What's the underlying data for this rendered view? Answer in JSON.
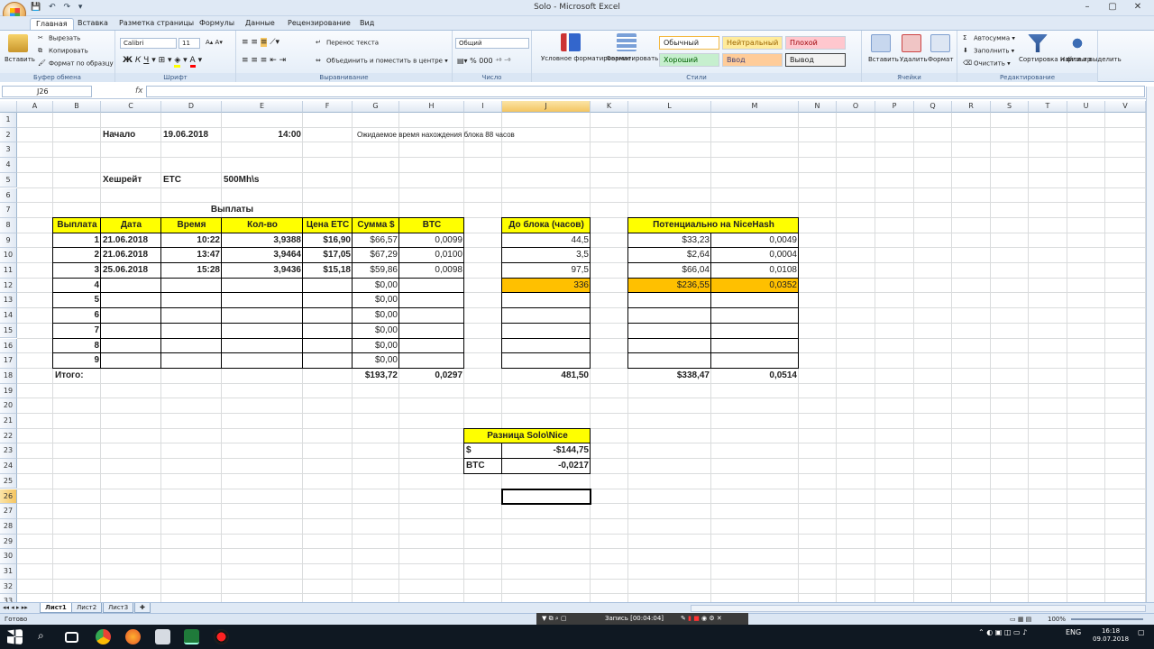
{
  "window": {
    "title": "Solo - Microsoft Excel",
    "controls": [
      "–",
      "▢",
      "✕"
    ]
  },
  "ribbon_tabs": [
    "Главная",
    "Вставка",
    "Разметка страницы",
    "Формулы",
    "Данные",
    "Рецензирование",
    "Вид"
  ],
  "ribbon": {
    "clipboard": {
      "label": "Буфер обмена",
      "paste": "Вставить",
      "cut": "Вырезать",
      "copy": "Копировать",
      "format_painter": "Формат по образцу"
    },
    "font": {
      "label": "Шрифт",
      "name": "Calibri",
      "size": "11"
    },
    "alignment": {
      "label": "Выравнивание",
      "wrap": "Перенос текста",
      "merge": "Объединить и поместить в центре"
    },
    "number": {
      "label": "Число",
      "format": "Общий"
    },
    "styles": {
      "label": "Стили",
      "cond_format": "Условное форматирование",
      "as_table": "Форматировать как таблицу",
      "normal": "Обычный",
      "neutral": "Нейтральный",
      "bad": "Плохой",
      "good": "Хороший",
      "input": "Ввод",
      "output": "Вывод"
    },
    "cells": {
      "label": "Ячейки",
      "insert": "Вставить",
      "delete": "Удалить",
      "format": "Формат"
    },
    "editing": {
      "label": "Редактирование",
      "autosum": "Автосумма",
      "fill": "Заполнить",
      "clear": "Очистить",
      "sort": "Сортировка и фильтр",
      "find": "Найти и выделить"
    }
  },
  "formula_bar": {
    "name_box": "J26",
    "fx": "fx",
    "formula": ""
  },
  "columns": [
    "A",
    "B",
    "C",
    "D",
    "E",
    "F",
    "G",
    "H",
    "I",
    "J",
    "K",
    "L",
    "M",
    "N",
    "O",
    "P",
    "Q",
    "R",
    "S",
    "T",
    "U",
    "V"
  ],
  "rows": [
    "1",
    "2",
    "3",
    "4",
    "5",
    "6",
    "7",
    "8",
    "9",
    "10",
    "11",
    "12",
    "13",
    "14",
    "15",
    "16",
    "17",
    "18",
    "19",
    "20",
    "21",
    "22",
    "23",
    "24",
    "25",
    "26",
    "27",
    "28",
    "29",
    "30",
    "31",
    "32",
    "33",
    "34"
  ],
  "cells": {
    "start_label": "Начало",
    "start_date": "19.06.2018",
    "start_time": "14:00",
    "expected_note": "Ожидаемое время нахождения блока 88 часов",
    "hashrate_label": "Хешрейт",
    "coin": "ETC",
    "hashrate": "500Mh\\s",
    "payouts_title": "Выплаты"
  },
  "payouts_table": {
    "headers": [
      "Выплата",
      "Дата",
      "Время",
      "Кол-во",
      "Цена ETC",
      "Сумма $",
      "BTC"
    ],
    "rows": [
      [
        "1",
        "21.06.2018",
        "10:22",
        "3,9388",
        "$16,90",
        "$66,57",
        "0,0099"
      ],
      [
        "2",
        "21.06.2018",
        "13:47",
        "3,9464",
        "$17,05",
        "$67,29",
        "0,0100"
      ],
      [
        "3",
        "25.06.2018",
        "15:28",
        "3,9436",
        "$15,18",
        "$59,86",
        "0,0098"
      ],
      [
        "4",
        "",
        "",
        "",
        "",
        "$0,00",
        ""
      ],
      [
        "5",
        "",
        "",
        "",
        "",
        "$0,00",
        ""
      ],
      [
        "6",
        "",
        "",
        "",
        "",
        "$0,00",
        ""
      ],
      [
        "7",
        "",
        "",
        "",
        "",
        "$0,00",
        ""
      ],
      [
        "8",
        "",
        "",
        "",
        "",
        "$0,00",
        ""
      ],
      [
        "9",
        "",
        "",
        "",
        "",
        "$0,00",
        ""
      ]
    ],
    "total_label": "Итого:",
    "total_usd": "$193,72",
    "total_btc": "0,0297"
  },
  "block_table": {
    "header": "До блока (часов)",
    "values": [
      "44,5",
      "3,5",
      "97,5",
      "336",
      "",
      "",
      "",
      "",
      ""
    ],
    "total": "481,50"
  },
  "nicehash_table": {
    "header": "Потенциально на NiceHash",
    "rows": [
      [
        "$33,23",
        "0,0049"
      ],
      [
        "$2,64",
        "0,0004"
      ],
      [
        "$66,04",
        "0,0108"
      ],
      [
        "$236,55",
        "0,0352"
      ],
      [
        "",
        ""
      ],
      [
        "",
        ""
      ],
      [
        "",
        ""
      ],
      [
        "",
        ""
      ],
      [
        "",
        ""
      ]
    ],
    "total_usd": "$338,47",
    "total_btc": "0,0514"
  },
  "diff_table": {
    "header": "Разница Solo\\Nice",
    "rows": [
      [
        "$",
        "-$144,75"
      ],
      [
        "BTC",
        "-0,0217"
      ]
    ]
  },
  "sheets": [
    "Лист1",
    "Лист2",
    "Лист3"
  ],
  "status": {
    "ready": "Готово",
    "recording": "Запись [00:04:04]",
    "zoom": "100%"
  },
  "tray": {
    "lang": "ENG",
    "time": "16:18",
    "date": "09.07.2018"
  },
  "colors": {
    "yellow": "#ffff00",
    "orange": "#ffc000",
    "selected_header": "#f4c561"
  }
}
